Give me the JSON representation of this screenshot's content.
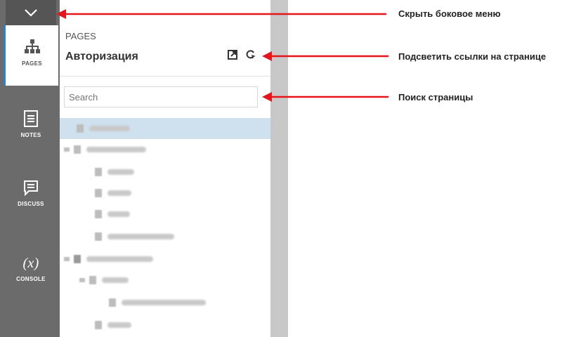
{
  "rail": {
    "items": [
      {
        "label": "PAGES",
        "icon": "sitemap-icon"
      },
      {
        "label": "NOTES",
        "icon": "notes-icon"
      },
      {
        "label": "DISCUSS",
        "icon": "discuss-icon"
      },
      {
        "label": "CONSOLE",
        "icon": "console-icon"
      }
    ],
    "console_glyph": "(x)"
  },
  "panel": {
    "caption": "PAGES",
    "title": "Авторизация",
    "search_placeholder": "Search"
  },
  "annotations": {
    "hide_menu": "Скрыть боковое меню",
    "highlight_links": "Подсветить ссылки на странице",
    "page_search": "Поиск страницы"
  },
  "colors": {
    "arrow": "#e8141b",
    "selected_row": "#cfe1ef",
    "rail": "#6b6b6b"
  }
}
